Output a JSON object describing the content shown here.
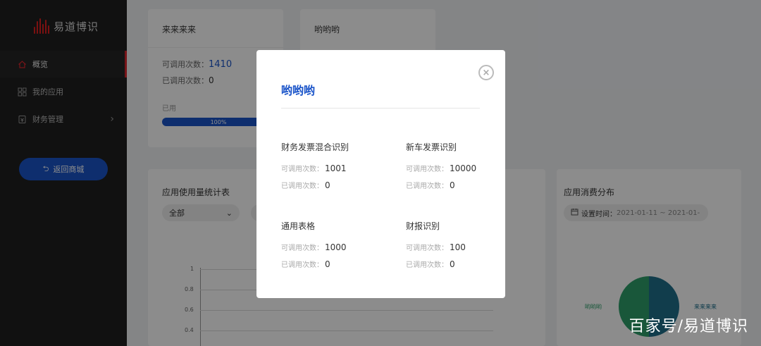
{
  "sidebar": {
    "logo_text": "易道博识",
    "items": [
      {
        "label": "概览",
        "icon": "home-icon"
      },
      {
        "label": "我的应用",
        "icon": "grid-icon"
      },
      {
        "label": "财务管理",
        "icon": "finance-icon"
      }
    ],
    "return_button": "返回商城"
  },
  "cards": {
    "card1": {
      "title": "来来来来",
      "available_label": "可调用次数：",
      "available_value": "1410",
      "used_label": "已调用次数：",
      "used_value": "0",
      "progress_label": "已用",
      "progress_value": "100%",
      "progress_fraction": 1.0
    },
    "card2": {
      "title": "哟哟哟"
    },
    "usage_chart": {
      "title": "应用使用量统计表",
      "filter_value": "全部",
      "ticks": [
        "1",
        "0.8",
        "0.6",
        "0.4"
      ]
    },
    "consumption": {
      "title": "应用消费分布",
      "date_label": "设置时间：",
      "date_value": "2021-01-11 ~ 2021-01-",
      "legend_left": "哟哟哟",
      "legend_right": "来来来来"
    }
  },
  "modal": {
    "title": "哟哟哟",
    "services": [
      {
        "name": "财务发票混合识别",
        "available_label": "可调用次数：",
        "available": "1001",
        "used_label": "已调用次数：",
        "used": "0"
      },
      {
        "name": "新车发票识别",
        "available_label": "可调用次数：",
        "available": "10000",
        "used_label": "已调用次数：",
        "used": "0"
      },
      {
        "name": "通用表格",
        "available_label": "可调用次数：",
        "available": "1000",
        "used_label": "已调用次数：",
        "used": "0"
      },
      {
        "name": "财报识别",
        "available_label": "可调用次数：",
        "available": "100",
        "used_label": "已调用次数：",
        "used": "0"
      }
    ]
  },
  "watermark": "百家号/易道博识",
  "colors": {
    "brand": "#1a54c9",
    "accent": "#d9262c",
    "sidebar": "#1f1f1f"
  }
}
